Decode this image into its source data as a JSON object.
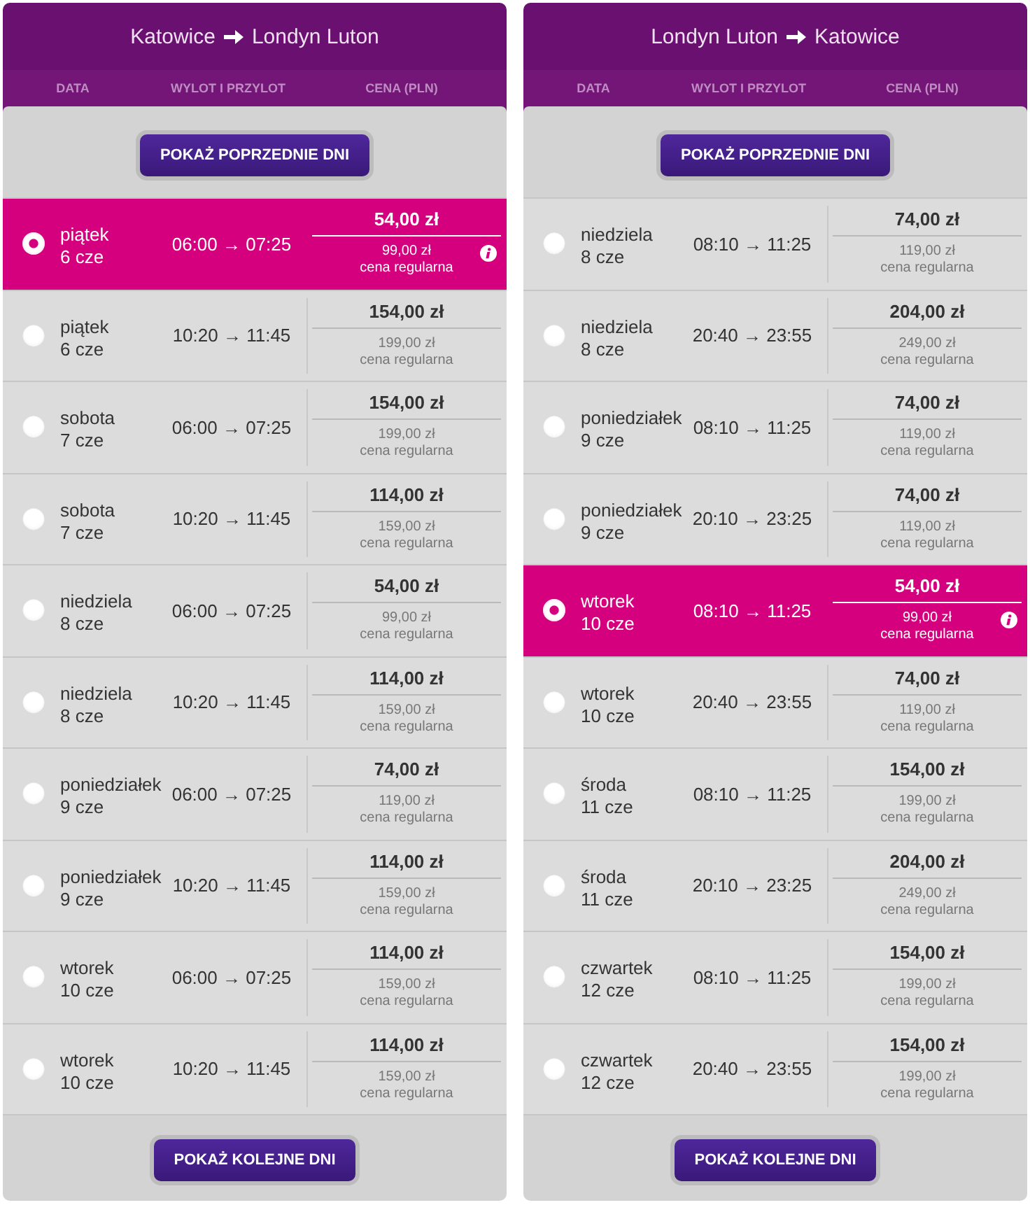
{
  "panels": [
    {
      "route": {
        "from": "Katowice",
        "to": "Londyn Luton"
      },
      "columns": [
        "DATA",
        "WYLOT I PRZYLOT",
        "CENA (PLN)"
      ],
      "prev_button": "POKAŻ POPRZEDNIE DNI",
      "flights": [
        {
          "day": "piątek",
          "date": "6 cze",
          "times": "06:00 → 07:25",
          "price": "54,00 zł",
          "regular_price": "99,00 zł",
          "regular_label": "cena regularna",
          "selected": true
        },
        {
          "day": "piątek",
          "date": "6 cze",
          "times": "10:20 → 11:45",
          "price": "154,00 zł",
          "regular_price": "199,00 zł",
          "regular_label": "cena regularna",
          "selected": false
        },
        {
          "day": "sobota",
          "date": "7 cze",
          "times": "06:00 → 07:25",
          "price": "154,00 zł",
          "regular_price": "199,00 zł",
          "regular_label": "cena regularna",
          "selected": false
        },
        {
          "day": "sobota",
          "date": "7 cze",
          "times": "10:20 → 11:45",
          "price": "114,00 zł",
          "regular_price": "159,00 zł",
          "regular_label": "cena regularna",
          "selected": false
        },
        {
          "day": "niedziela",
          "date": "8 cze",
          "times": "06:00 → 07:25",
          "price": "54,00 zł",
          "regular_price": "99,00 zł",
          "regular_label": "cena regularna",
          "selected": false
        },
        {
          "day": "niedziela",
          "date": "8 cze",
          "times": "10:20 → 11:45",
          "price": "114,00 zł",
          "regular_price": "159,00 zł",
          "regular_label": "cena regularna",
          "selected": false
        },
        {
          "day": "poniedziałek",
          "date": "9 cze",
          "times": "06:00 → 07:25",
          "price": "74,00 zł",
          "regular_price": "119,00 zł",
          "regular_label": "cena regularna",
          "selected": false
        },
        {
          "day": "poniedziałek",
          "date": "9 cze",
          "times": "10:20 → 11:45",
          "price": "114,00 zł",
          "regular_price": "159,00 zł",
          "regular_label": "cena regularna",
          "selected": false
        },
        {
          "day": "wtorek",
          "date": "10 cze",
          "times": "06:00 → 07:25",
          "price": "114,00 zł",
          "regular_price": "159,00 zł",
          "regular_label": "cena regularna",
          "selected": false
        },
        {
          "day": "wtorek",
          "date": "10 cze",
          "times": "10:20 → 11:45",
          "price": "114,00 zł",
          "regular_price": "159,00 zł",
          "regular_label": "cena regularna",
          "selected": false
        }
      ],
      "next_button": "POKAŻ KOLEJNE DNI"
    },
    {
      "route": {
        "from": "Londyn Luton",
        "to": "Katowice"
      },
      "columns": [
        "DATA",
        "WYLOT I PRZYLOT",
        "CENA (PLN)"
      ],
      "prev_button": "POKAŻ POPRZEDNIE DNI",
      "flights": [
        {
          "day": "niedziela",
          "date": "8 cze",
          "times": "08:10 → 11:25",
          "price": "74,00 zł",
          "regular_price": "119,00 zł",
          "regular_label": "cena regularna",
          "selected": false
        },
        {
          "day": "niedziela",
          "date": "8 cze",
          "times": "20:40 → 23:55",
          "price": "204,00 zł",
          "regular_price": "249,00 zł",
          "regular_label": "cena regularna",
          "selected": false
        },
        {
          "day": "poniedziałek",
          "date": "9 cze",
          "times": "08:10 → 11:25",
          "price": "74,00 zł",
          "regular_price": "119,00 zł",
          "regular_label": "cena regularna",
          "selected": false
        },
        {
          "day": "poniedziałek",
          "date": "9 cze",
          "times": "20:10 → 23:25",
          "price": "74,00 zł",
          "regular_price": "119,00 zł",
          "regular_label": "cena regularna",
          "selected": false
        },
        {
          "day": "wtorek",
          "date": "10 cze",
          "times": "08:10 → 11:25",
          "price": "54,00 zł",
          "regular_price": "99,00 zł",
          "regular_label": "cena regularna",
          "selected": true
        },
        {
          "day": "wtorek",
          "date": "10 cze",
          "times": "20:40 → 23:55",
          "price": "74,00 zł",
          "regular_price": "119,00 zł",
          "regular_label": "cena regularna",
          "selected": false
        },
        {
          "day": "środa",
          "date": "11 cze",
          "times": "08:10 → 11:25",
          "price": "154,00 zł",
          "regular_price": "199,00 zł",
          "regular_label": "cena regularna",
          "selected": false
        },
        {
          "day": "środa",
          "date": "11 cze",
          "times": "20:10 → 23:25",
          "price": "204,00 zł",
          "regular_price": "249,00 zł",
          "regular_label": "cena regularna",
          "selected": false
        },
        {
          "day": "czwartek",
          "date": "12 cze",
          "times": "08:10 → 11:25",
          "price": "154,00 zł",
          "regular_price": "199,00 zł",
          "regular_label": "cena regularna",
          "selected": false
        },
        {
          "day": "czwartek",
          "date": "12 cze",
          "times": "20:40 → 23:55",
          "price": "154,00 zł",
          "regular_price": "199,00 zł",
          "regular_label": "cena regularna",
          "selected": false
        }
      ],
      "next_button": "POKAŻ KOLEJNE DNI"
    }
  ]
}
